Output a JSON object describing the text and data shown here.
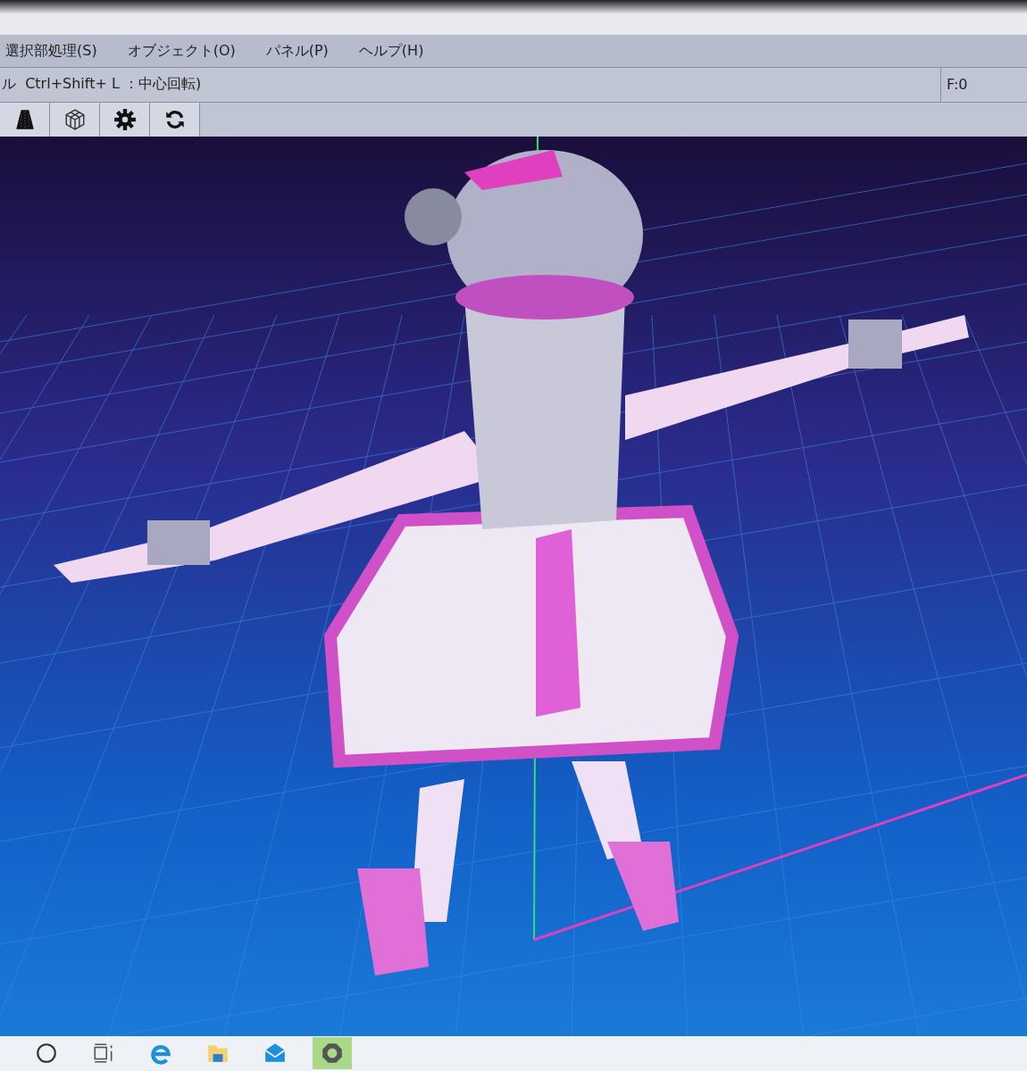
{
  "menu_bar": {
    "items": [
      {
        "label": "選択部処理(S)"
      },
      {
        "label": "オブジェクト(O)"
      },
      {
        "label": "パネル(P)"
      },
      {
        "label": "ヘルプ(H)"
      }
    ]
  },
  "status_line": {
    "text": "ル  Ctrl+Shift+ L ：中心回転)",
    "frame": "F:0"
  }
}
